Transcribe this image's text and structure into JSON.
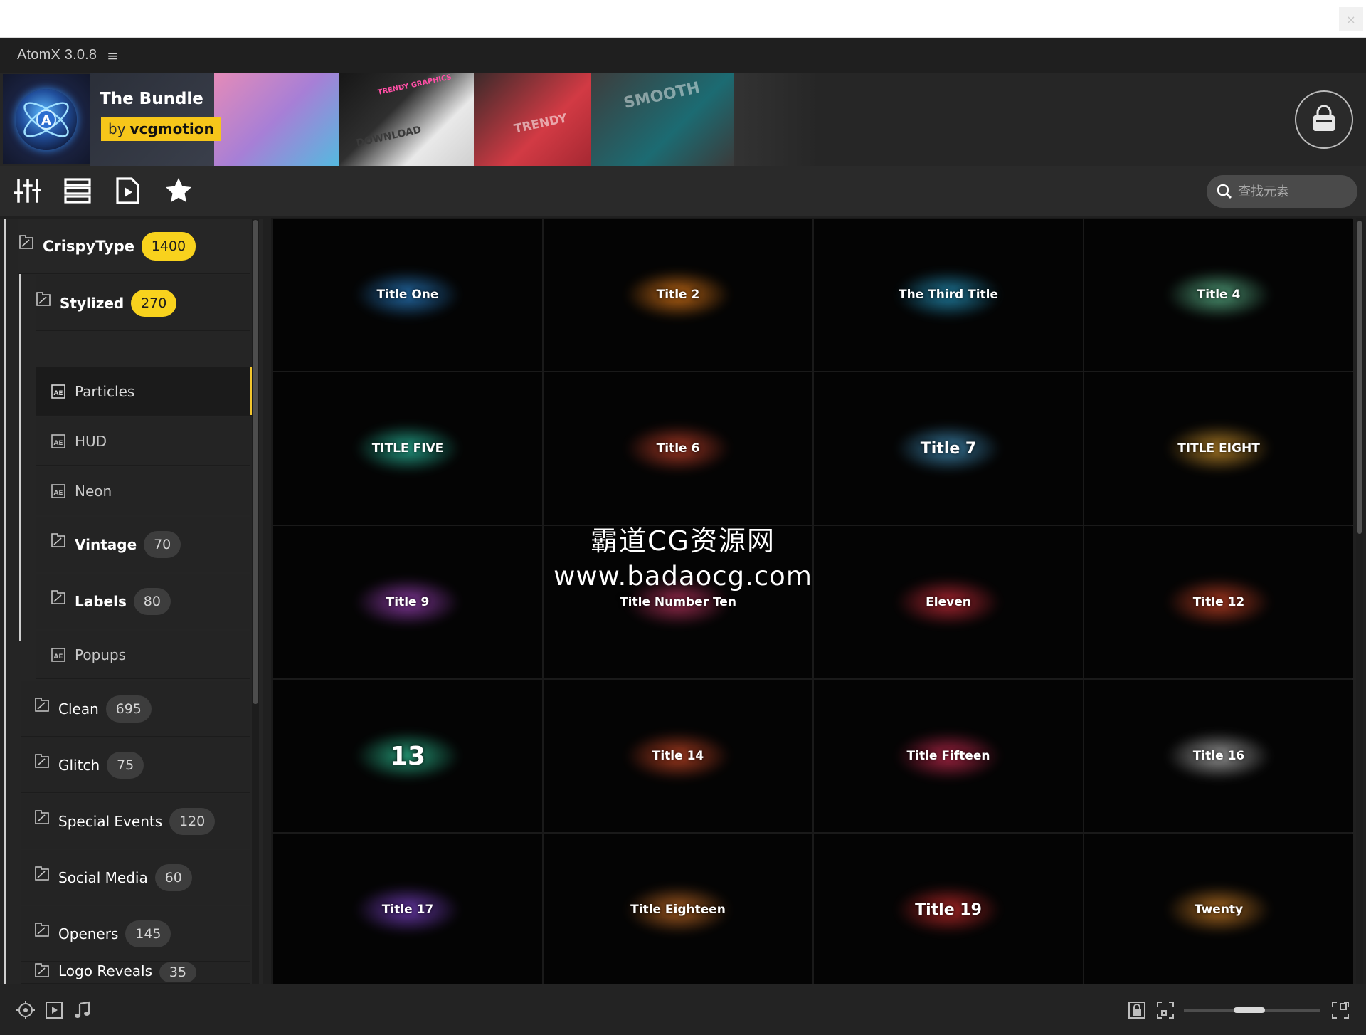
{
  "window": {
    "close_glyph": "×"
  },
  "titlebar": {
    "app_name": "AtomX 3.0.8",
    "menu_glyph": "≡"
  },
  "banner": {
    "title": "The Bundle",
    "by_prefix": "by",
    "by_name": "vcgmotion",
    "tiles": [
      "TRENDY GRAPHICS",
      "DOWNLOAD",
      "TRENDY",
      "SMOOTH"
    ],
    "accent": "#f6c61a"
  },
  "toolbar": {
    "icons": [
      "sliders-icon",
      "list-view-icon",
      "media-file-icon",
      "star-icon"
    ],
    "search_placeholder": "查找元素"
  },
  "sidebar": {
    "root": {
      "label": "CrispyType",
      "count": "1400"
    },
    "stylized": {
      "label": "Stylized",
      "count": "270"
    },
    "items": [
      {
        "label": "Particles"
      },
      {
        "label": "HUD"
      },
      {
        "label": "Neon"
      },
      {
        "label": "Vintage",
        "count": "70"
      },
      {
        "label": "Labels",
        "count": "80"
      },
      {
        "label": "Popups"
      }
    ],
    "categories": [
      {
        "label": "Clean",
        "count": "695"
      },
      {
        "label": "Glitch",
        "count": "75"
      },
      {
        "label": "Special Events",
        "count": "120"
      },
      {
        "label": "Social Media",
        "count": "60"
      },
      {
        "label": "Openers",
        "count": "145"
      },
      {
        "label": "Logo Reveals",
        "count": "35"
      }
    ]
  },
  "grid": {
    "items": [
      {
        "title": "Title One",
        "color": "#2f8fe0"
      },
      {
        "title": "Title 2",
        "color": "#ff8a1c"
      },
      {
        "title": "The Third Title",
        "color": "#2aa9d8"
      },
      {
        "title": "Title 4",
        "color": "#6ad0a0"
      },
      {
        "title": "TITLE FIVE",
        "color": "#2fd4b3"
      },
      {
        "title": "Title 6",
        "color": "#d9482f"
      },
      {
        "title": "Title 7",
        "color": "#4aa3d4"
      },
      {
        "title": "TITLE EIGHT",
        "color": "#e0a030"
      },
      {
        "title": "Title 9",
        "color": "#b04ad0"
      },
      {
        "title": "Title Number Ten",
        "color": "#d03a6a"
      },
      {
        "title": "Eleven",
        "color": "#e0303f"
      },
      {
        "title": "Title 12",
        "color": "#e04a2a"
      },
      {
        "title": "13",
        "color": "#30d0a0"
      },
      {
        "title": "Title 14",
        "color": "#e04f2a"
      },
      {
        "title": "Title Fifteen",
        "color": "#e0305a"
      },
      {
        "title": "Title 16",
        "color": "#c9c9c9"
      },
      {
        "title": "Title 17",
        "color": "#8a4ae0"
      },
      {
        "title": "Title Eighteen",
        "color": "#e07a2a"
      },
      {
        "title": "Title 19",
        "color": "#e03030"
      },
      {
        "title": "Twenty",
        "color": "#e08a2a"
      }
    ]
  },
  "watermark": {
    "line1": "霸道CG资源网",
    "line2": "www.badaocg.com"
  },
  "bottombar": {
    "icons": [
      "target-icon",
      "video-preview-icon",
      "music-note-icon",
      "lock-icon",
      "fit-frame-icon",
      "expand-icon"
    ],
    "zoom_level": 0.38
  }
}
